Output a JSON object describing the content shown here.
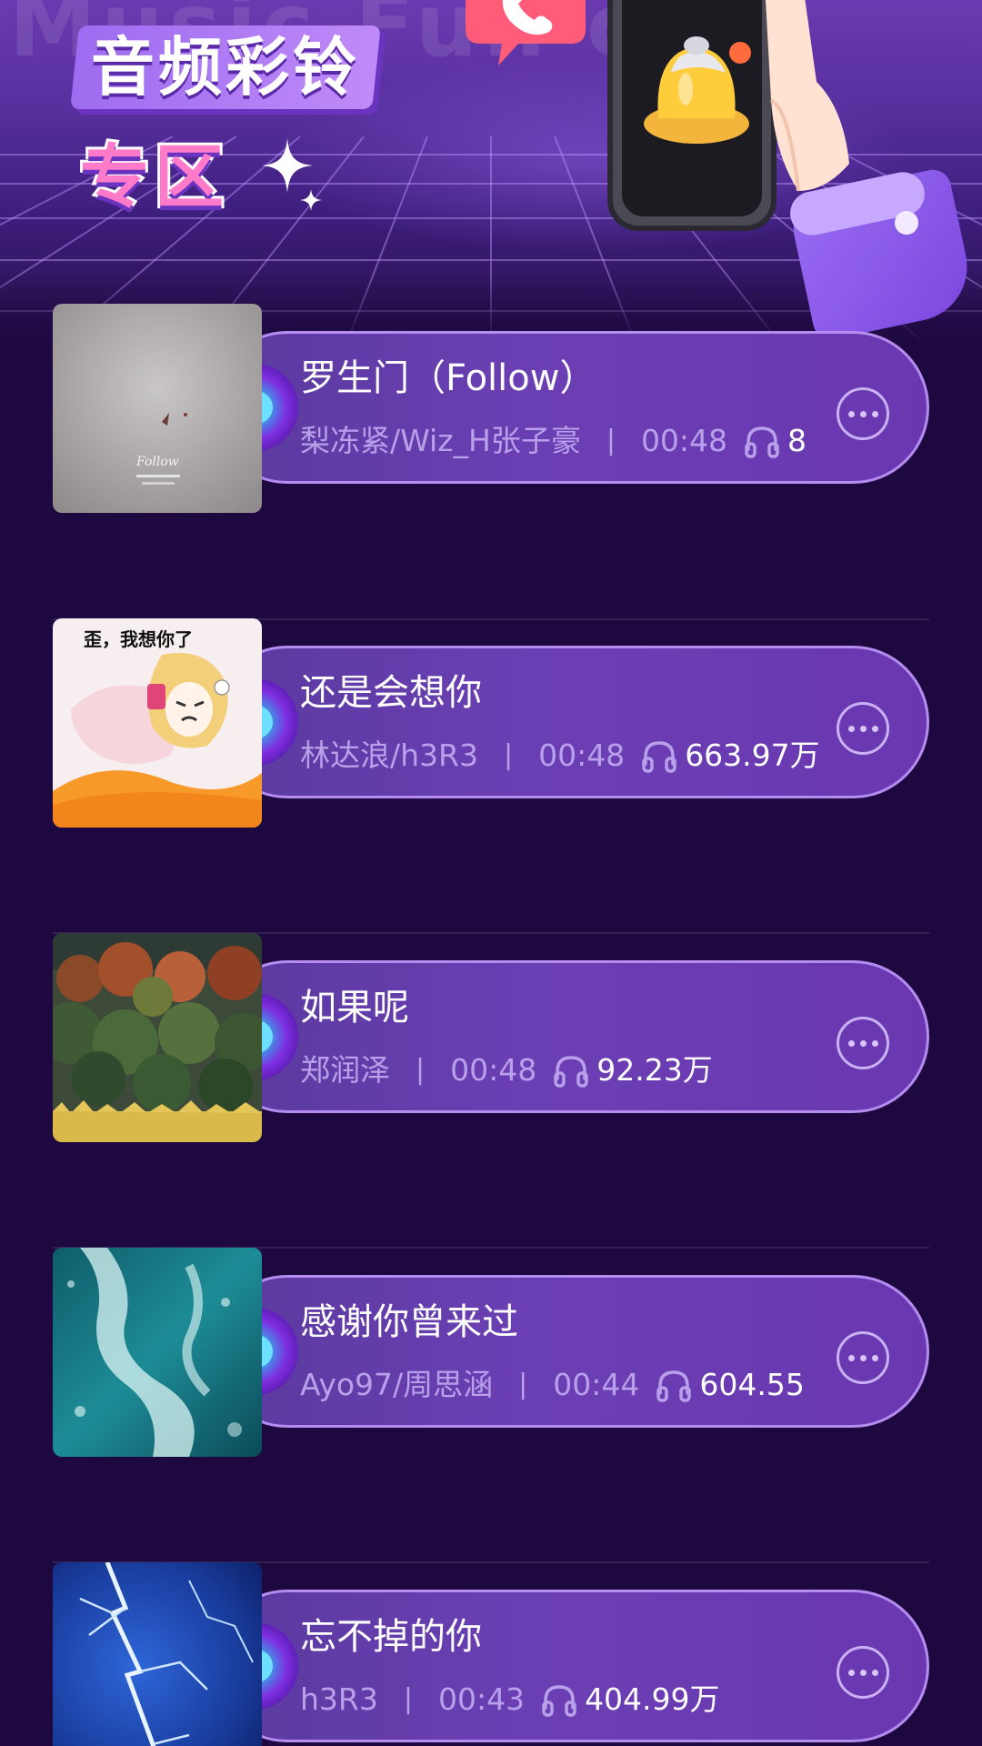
{
  "banner": {
    "background_text": "Music  Fun  call",
    "title_line1": "音频彩铃",
    "title_line2": "专区"
  },
  "colors": {
    "page_background": "#1e0840",
    "pill_fill": "#6b3fb4",
    "pill_border": "#b58df0",
    "meta_text": "#b8a0ea",
    "title_text": "#ffffff",
    "disc_center": "#6ee0ff"
  },
  "songs": [
    {
      "title": "罗生门（Follow）",
      "artist": "梨冻紧/Wiz_H张子豪",
      "separator": "|",
      "duration": "00:48",
      "plays": "8",
      "cover": "grey-sky-cover",
      "cover_text": "Follow"
    },
    {
      "title": "还是会想你",
      "artist": "林达浪/h3R3",
      "separator": "|",
      "duration": "00:48",
      "plays": "663.97万",
      "cover": "anime-girl-cover",
      "cover_text": "歪，我想你了"
    },
    {
      "title": "如果呢",
      "artist": "郑润泽",
      "separator": "|",
      "duration": "00:48",
      "plays": "92.23万",
      "cover": "autumn-forest-cover"
    },
    {
      "title": "感谢你曾来过",
      "artist": "Ayo97/周思涵",
      "separator": "|",
      "duration": "00:44",
      "plays": "604.55",
      "cover": "ocean-waves-cover"
    },
    {
      "title": "忘不掉的你",
      "artist": "h3R3",
      "separator": "|",
      "duration": "00:43",
      "plays": "404.99万",
      "cover": "lightning-storm-cover"
    }
  ],
  "icons": {
    "listen_count": "headphones-icon",
    "more": "more-options-icon",
    "bell": "bell-icon",
    "call": "phone-call-icon",
    "sparkle": "sparkle-icon"
  }
}
